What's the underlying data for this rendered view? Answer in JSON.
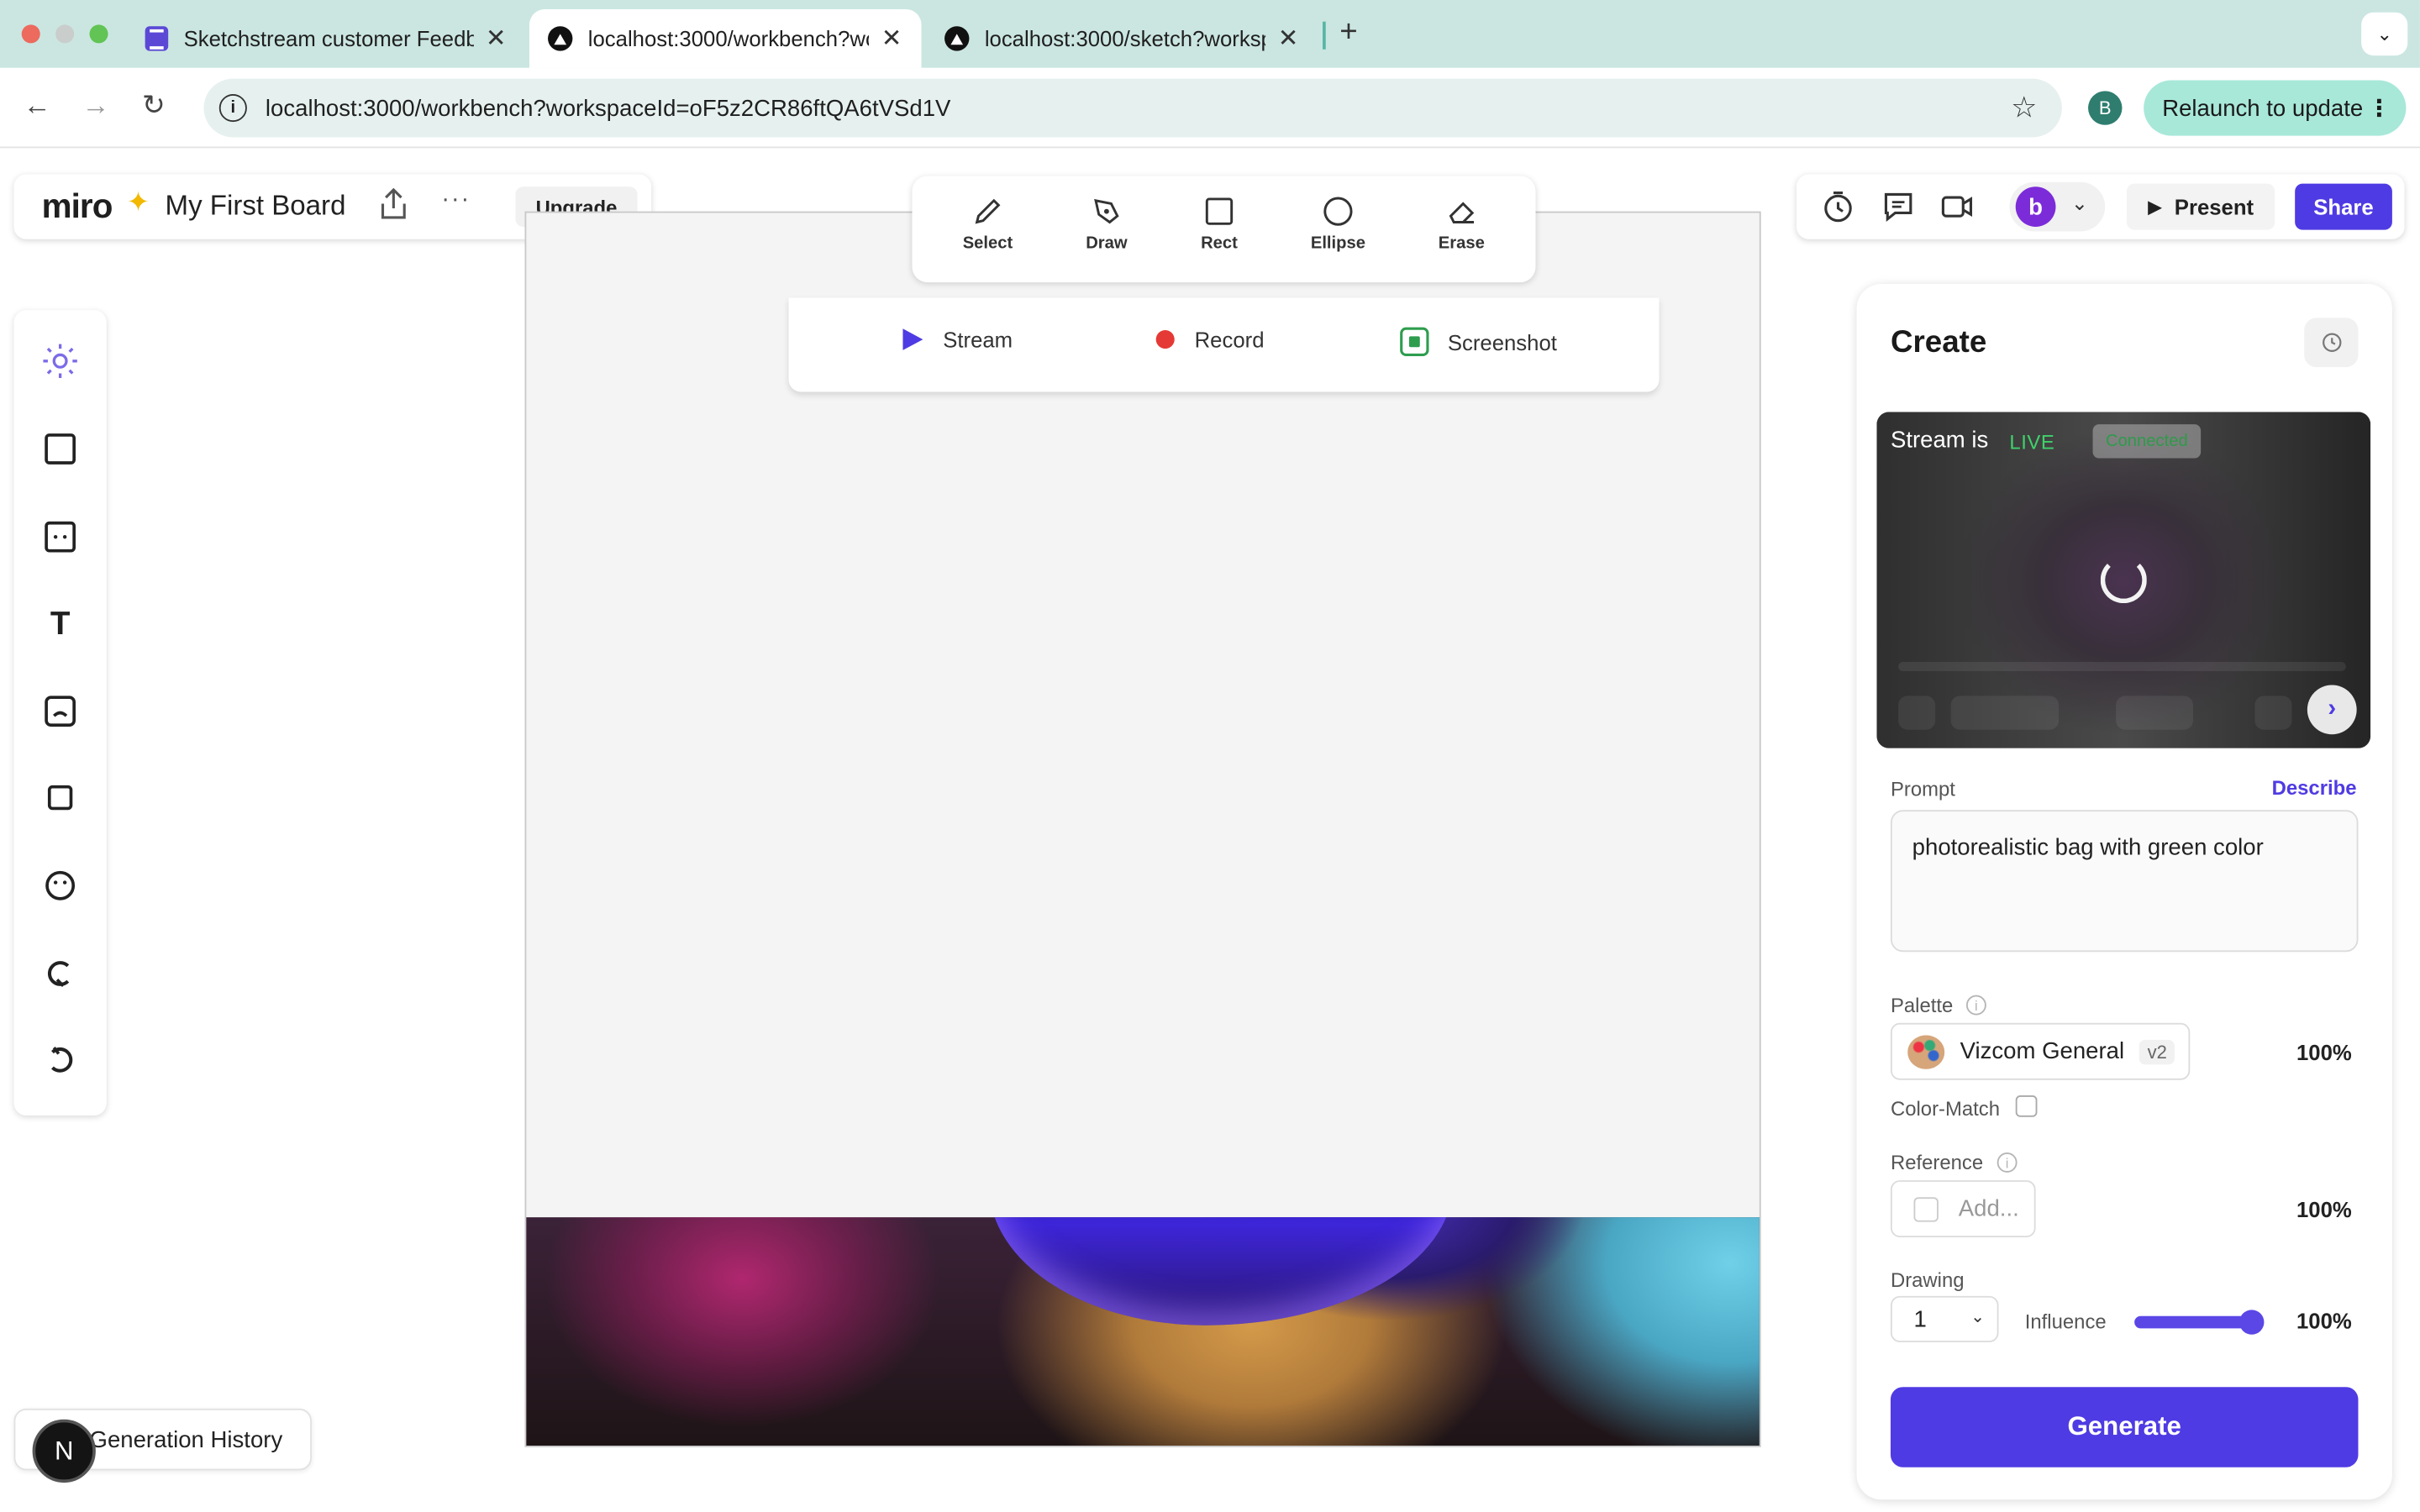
{
  "browser": {
    "tabs": [
      {
        "label": "Sketchstream customer Feedback",
        "icon": "sheets-icon",
        "active": false
      },
      {
        "label": "localhost:3000/workbench?workspaceId",
        "icon": "vercel-icon",
        "active": true
      },
      {
        "label": "localhost:3000/sketch?workspace",
        "icon": "vercel-icon",
        "active": false
      }
    ],
    "url": "localhost:3000/workbench?workspaceId=oF5z2CR86ftQA6tVSd1V",
    "profile_initial": "B",
    "relaunch_label": "Relaunch to update"
  },
  "board": {
    "logo": "miro",
    "title": "My First Board",
    "more": "···",
    "upgrade_label": "Upgrade"
  },
  "draw_tools": [
    {
      "label": "Select",
      "icon": "pencil-icon"
    },
    {
      "label": "Draw",
      "icon": "pen-nib-icon"
    },
    {
      "label": "Rect",
      "icon": "square-icon"
    },
    {
      "label": "Ellipse",
      "icon": "circle-icon"
    },
    {
      "label": "Erase",
      "icon": "eraser-icon"
    }
  ],
  "stream_bar": {
    "stream_label": "Stream",
    "record_label": "Record",
    "screenshot_label": "Screenshot"
  },
  "top_right": {
    "avatar_initial": "b",
    "present_label": "Present",
    "share_label": "Share"
  },
  "create_panel": {
    "title": "Create",
    "preview_status": "Stream is",
    "preview_live": "LIVE",
    "preview_pill": "Connected",
    "prompt_label": "Prompt",
    "describe_label": "Describe",
    "prompt_value": "photorealistic bag with green color",
    "palette_label": "Palette",
    "palette_value": "Vizcom General",
    "palette_version": "v2",
    "palette_pct": "100%",
    "color_match_label": "Color-Match",
    "reference_label": "Reference",
    "reference_placeholder": "Add...",
    "reference_pct": "100%",
    "drawing_label": "Drawing",
    "drawing_value": "1",
    "influence_label": "Influence",
    "influence_pct": "100%",
    "influence_level": 1.0,
    "generate_label": "Generate"
  },
  "generation_history_label": "Generation History",
  "n_badge": "N",
  "colors": {
    "accent": "#4f3be3",
    "live": "#3fd16b",
    "record": "#e53935",
    "screenshot": "#2e9d4e"
  }
}
